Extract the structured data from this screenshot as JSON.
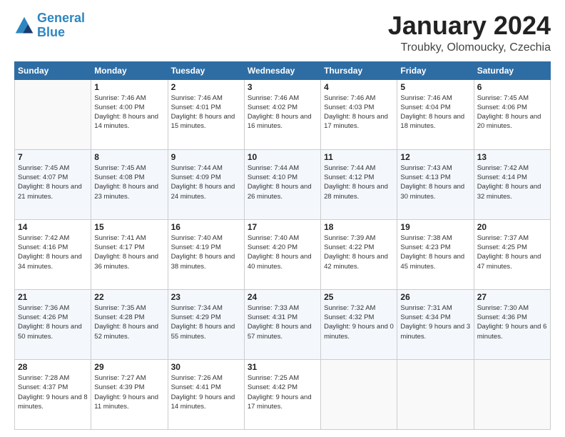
{
  "logo": {
    "line1": "General",
    "line2": "Blue"
  },
  "title": "January 2024",
  "subtitle": "Troubky, Olomoucky, Czechia",
  "days_of_week": [
    "Sunday",
    "Monday",
    "Tuesday",
    "Wednesday",
    "Thursday",
    "Friday",
    "Saturday"
  ],
  "weeks": [
    [
      {
        "day": "",
        "sunrise": "",
        "sunset": "",
        "daylight": ""
      },
      {
        "day": "1",
        "sunrise": "7:46 AM",
        "sunset": "4:00 PM",
        "daylight": "8 hours and 14 minutes."
      },
      {
        "day": "2",
        "sunrise": "7:46 AM",
        "sunset": "4:01 PM",
        "daylight": "8 hours and 15 minutes."
      },
      {
        "day": "3",
        "sunrise": "7:46 AM",
        "sunset": "4:02 PM",
        "daylight": "8 hours and 16 minutes."
      },
      {
        "day": "4",
        "sunrise": "7:46 AM",
        "sunset": "4:03 PM",
        "daylight": "8 hours and 17 minutes."
      },
      {
        "day": "5",
        "sunrise": "7:46 AM",
        "sunset": "4:04 PM",
        "daylight": "8 hours and 18 minutes."
      },
      {
        "day": "6",
        "sunrise": "7:45 AM",
        "sunset": "4:06 PM",
        "daylight": "8 hours and 20 minutes."
      }
    ],
    [
      {
        "day": "7",
        "sunrise": "7:45 AM",
        "sunset": "4:07 PM",
        "daylight": "8 hours and 21 minutes."
      },
      {
        "day": "8",
        "sunrise": "7:45 AM",
        "sunset": "4:08 PM",
        "daylight": "8 hours and 23 minutes."
      },
      {
        "day": "9",
        "sunrise": "7:44 AM",
        "sunset": "4:09 PM",
        "daylight": "8 hours and 24 minutes."
      },
      {
        "day": "10",
        "sunrise": "7:44 AM",
        "sunset": "4:10 PM",
        "daylight": "8 hours and 26 minutes."
      },
      {
        "day": "11",
        "sunrise": "7:44 AM",
        "sunset": "4:12 PM",
        "daylight": "8 hours and 28 minutes."
      },
      {
        "day": "12",
        "sunrise": "7:43 AM",
        "sunset": "4:13 PM",
        "daylight": "8 hours and 30 minutes."
      },
      {
        "day": "13",
        "sunrise": "7:42 AM",
        "sunset": "4:14 PM",
        "daylight": "8 hours and 32 minutes."
      }
    ],
    [
      {
        "day": "14",
        "sunrise": "7:42 AM",
        "sunset": "4:16 PM",
        "daylight": "8 hours and 34 minutes."
      },
      {
        "day": "15",
        "sunrise": "7:41 AM",
        "sunset": "4:17 PM",
        "daylight": "8 hours and 36 minutes."
      },
      {
        "day": "16",
        "sunrise": "7:40 AM",
        "sunset": "4:19 PM",
        "daylight": "8 hours and 38 minutes."
      },
      {
        "day": "17",
        "sunrise": "7:40 AM",
        "sunset": "4:20 PM",
        "daylight": "8 hours and 40 minutes."
      },
      {
        "day": "18",
        "sunrise": "7:39 AM",
        "sunset": "4:22 PM",
        "daylight": "8 hours and 42 minutes."
      },
      {
        "day": "19",
        "sunrise": "7:38 AM",
        "sunset": "4:23 PM",
        "daylight": "8 hours and 45 minutes."
      },
      {
        "day": "20",
        "sunrise": "7:37 AM",
        "sunset": "4:25 PM",
        "daylight": "8 hours and 47 minutes."
      }
    ],
    [
      {
        "day": "21",
        "sunrise": "7:36 AM",
        "sunset": "4:26 PM",
        "daylight": "8 hours and 50 minutes."
      },
      {
        "day": "22",
        "sunrise": "7:35 AM",
        "sunset": "4:28 PM",
        "daylight": "8 hours and 52 minutes."
      },
      {
        "day": "23",
        "sunrise": "7:34 AM",
        "sunset": "4:29 PM",
        "daylight": "8 hours and 55 minutes."
      },
      {
        "day": "24",
        "sunrise": "7:33 AM",
        "sunset": "4:31 PM",
        "daylight": "8 hours and 57 minutes."
      },
      {
        "day": "25",
        "sunrise": "7:32 AM",
        "sunset": "4:32 PM",
        "daylight": "9 hours and 0 minutes."
      },
      {
        "day": "26",
        "sunrise": "7:31 AM",
        "sunset": "4:34 PM",
        "daylight": "9 hours and 3 minutes."
      },
      {
        "day": "27",
        "sunrise": "7:30 AM",
        "sunset": "4:36 PM",
        "daylight": "9 hours and 6 minutes."
      }
    ],
    [
      {
        "day": "28",
        "sunrise": "7:28 AM",
        "sunset": "4:37 PM",
        "daylight": "9 hours and 8 minutes."
      },
      {
        "day": "29",
        "sunrise": "7:27 AM",
        "sunset": "4:39 PM",
        "daylight": "9 hours and 11 minutes."
      },
      {
        "day": "30",
        "sunrise": "7:26 AM",
        "sunset": "4:41 PM",
        "daylight": "9 hours and 14 minutes."
      },
      {
        "day": "31",
        "sunrise": "7:25 AM",
        "sunset": "4:42 PM",
        "daylight": "9 hours and 17 minutes."
      },
      {
        "day": "",
        "sunrise": "",
        "sunset": "",
        "daylight": ""
      },
      {
        "day": "",
        "sunrise": "",
        "sunset": "",
        "daylight": ""
      },
      {
        "day": "",
        "sunrise": "",
        "sunset": "",
        "daylight": ""
      }
    ]
  ]
}
